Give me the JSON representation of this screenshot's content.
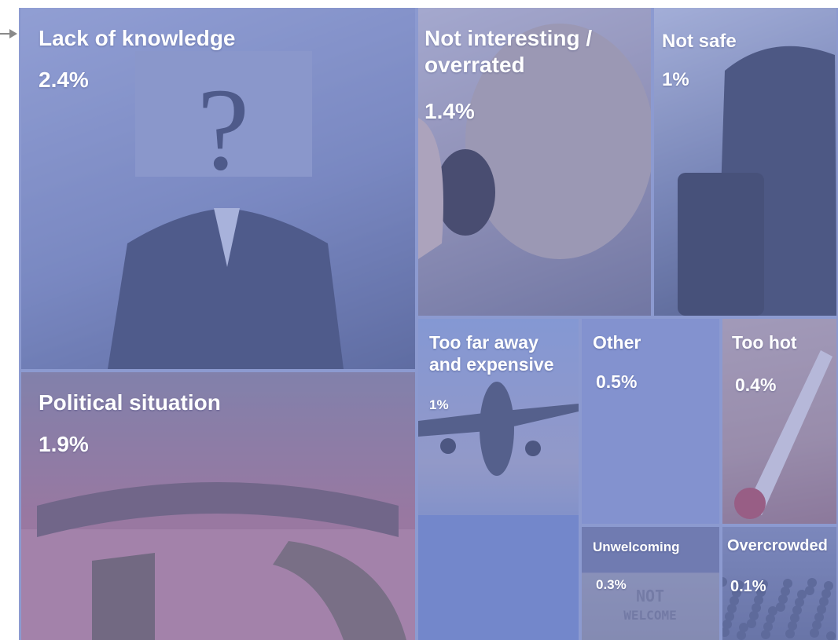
{
  "chart_data": {
    "type": "treemap",
    "items": [
      {
        "name": "Lack of knowledge",
        "value": 2.4,
        "value_label": "2.4%",
        "image": "person-holding-question-mark-sign"
      },
      {
        "name": "Not interesting / overrated",
        "value": 1.4,
        "value_label": "1.4%",
        "image": "woman-yawning"
      },
      {
        "name": "Not safe",
        "value": 1.0,
        "value_label": "1%",
        "image": "pickpocket-with-handbag"
      },
      {
        "name": "Political situation",
        "value": 1.9,
        "value_label": "1.9%",
        "image": "parliament-chamber"
      },
      {
        "name": "Too far away and expensive",
        "value": 1.0,
        "value_label": "1%",
        "image": "airplane-above-clouds"
      },
      {
        "name": "Other",
        "value": 0.5,
        "value_label": "0.5%",
        "image": ""
      },
      {
        "name": "Too hot",
        "value": 0.4,
        "value_label": "0.4%",
        "image": "thermometer"
      },
      {
        "name": "Unwelcoming",
        "value": 0.3,
        "value_label": "0.3%",
        "image": "not-welcome-doormat"
      },
      {
        "name": "Overcrowded",
        "value": 0.1,
        "value_label": "0.1%",
        "image": "crowd-of-people"
      }
    ],
    "unit": "%"
  },
  "colors": {
    "tile_overlay": "#7d8cca",
    "gutter": "#8c9ad0",
    "label_text": "#ffffff"
  },
  "icons": {
    "pointer": "arrow-right-icon"
  }
}
